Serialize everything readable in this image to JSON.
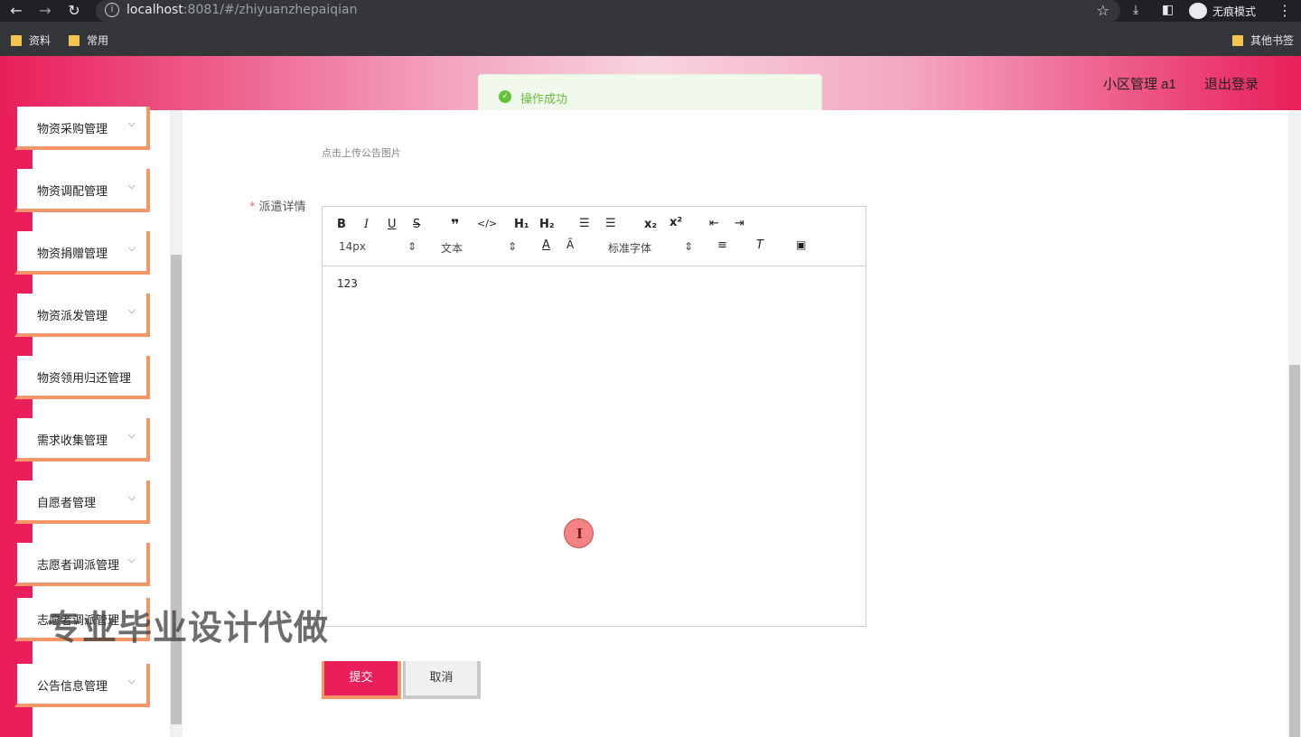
{
  "browser": {
    "url_host": "localhost",
    "url_rest": ":8081/#/zhiyuanzhepaiqian",
    "incognito_label": "无痕模式",
    "bookmarks": [
      "资料",
      "常用"
    ],
    "other_bookmarks": "其他书签"
  },
  "header": {
    "user": "小区管理 a1",
    "logout": "退出登录"
  },
  "toast": {
    "message": "操作成功",
    "color": "#67c23a"
  },
  "sidebar": {
    "items": [
      {
        "label": "物资采购管理",
        "expandable": true
      },
      {
        "label": "物资调配管理",
        "expandable": true
      },
      {
        "label": "物资捐赠管理",
        "expandable": true
      },
      {
        "label": "物资派发管理",
        "expandable": true
      },
      {
        "label": "物资领用归还管理",
        "expandable": false
      },
      {
        "label": "需求收集管理",
        "expandable": true
      },
      {
        "label": "自愿者管理",
        "expandable": true
      },
      {
        "label": "志愿者调派管理",
        "expandable": true
      },
      {
        "label": "志愿者调派管理",
        "expandable": false
      },
      {
        "label": "公告信息管理",
        "expandable": true
      }
    ]
  },
  "watermark": "专业毕业设计代做",
  "form": {
    "upload_hint": "点击上传公告图片",
    "detail_label": "派遣详情",
    "editor": {
      "font_size": "14px",
      "header_select": "文本",
      "font_family": "标准字体",
      "content": "123"
    },
    "submit": "提交",
    "cancel": "取消"
  },
  "colors": {
    "brand": "#e91e5a",
    "accent": "#f4956a"
  }
}
